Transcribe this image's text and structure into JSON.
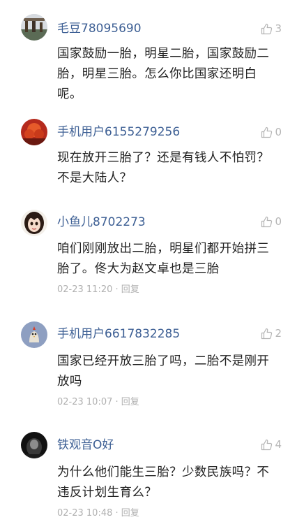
{
  "comments": [
    {
      "username": "毛豆78095690",
      "likes": "3",
      "text": "国家鼓励一胎，明星二胎，国家鼓励二胎，明星三胎。怎么你比国家还明白呢。",
      "time": "",
      "reply": ""
    },
    {
      "username": "手机用户6155279256",
      "likes": "0",
      "text": "现在放开三胎了？还是有钱人不怕罚？不是大陆人？",
      "time": "",
      "reply": ""
    },
    {
      "username": "小鱼儿8702273",
      "likes": "0",
      "text": "咱们刚刚放出二胎，明星们都开始拼三胎了。佟大为赵文卓也是三胎",
      "time": "02-23 11:20",
      "reply": "回复"
    },
    {
      "username": "手机用户6617832285",
      "likes": "2",
      "text": "国家已经开放三胎了吗，二胎不是刚开放吗",
      "time": "02-23 10:07",
      "reply": "回复"
    },
    {
      "username": "铁观音O好",
      "likes": "4",
      "text": "为什么他们能生三胎？少数民族吗？不违反计划生育么？",
      "time": "02-23 10:48",
      "reply": "回复"
    }
  ],
  "icons": {
    "like": "thumbs-up-icon"
  },
  "colors": {
    "username": "#3d5f94",
    "text": "#222222",
    "meta": "#b0b0b0",
    "likes": "#b4b4b4"
  }
}
